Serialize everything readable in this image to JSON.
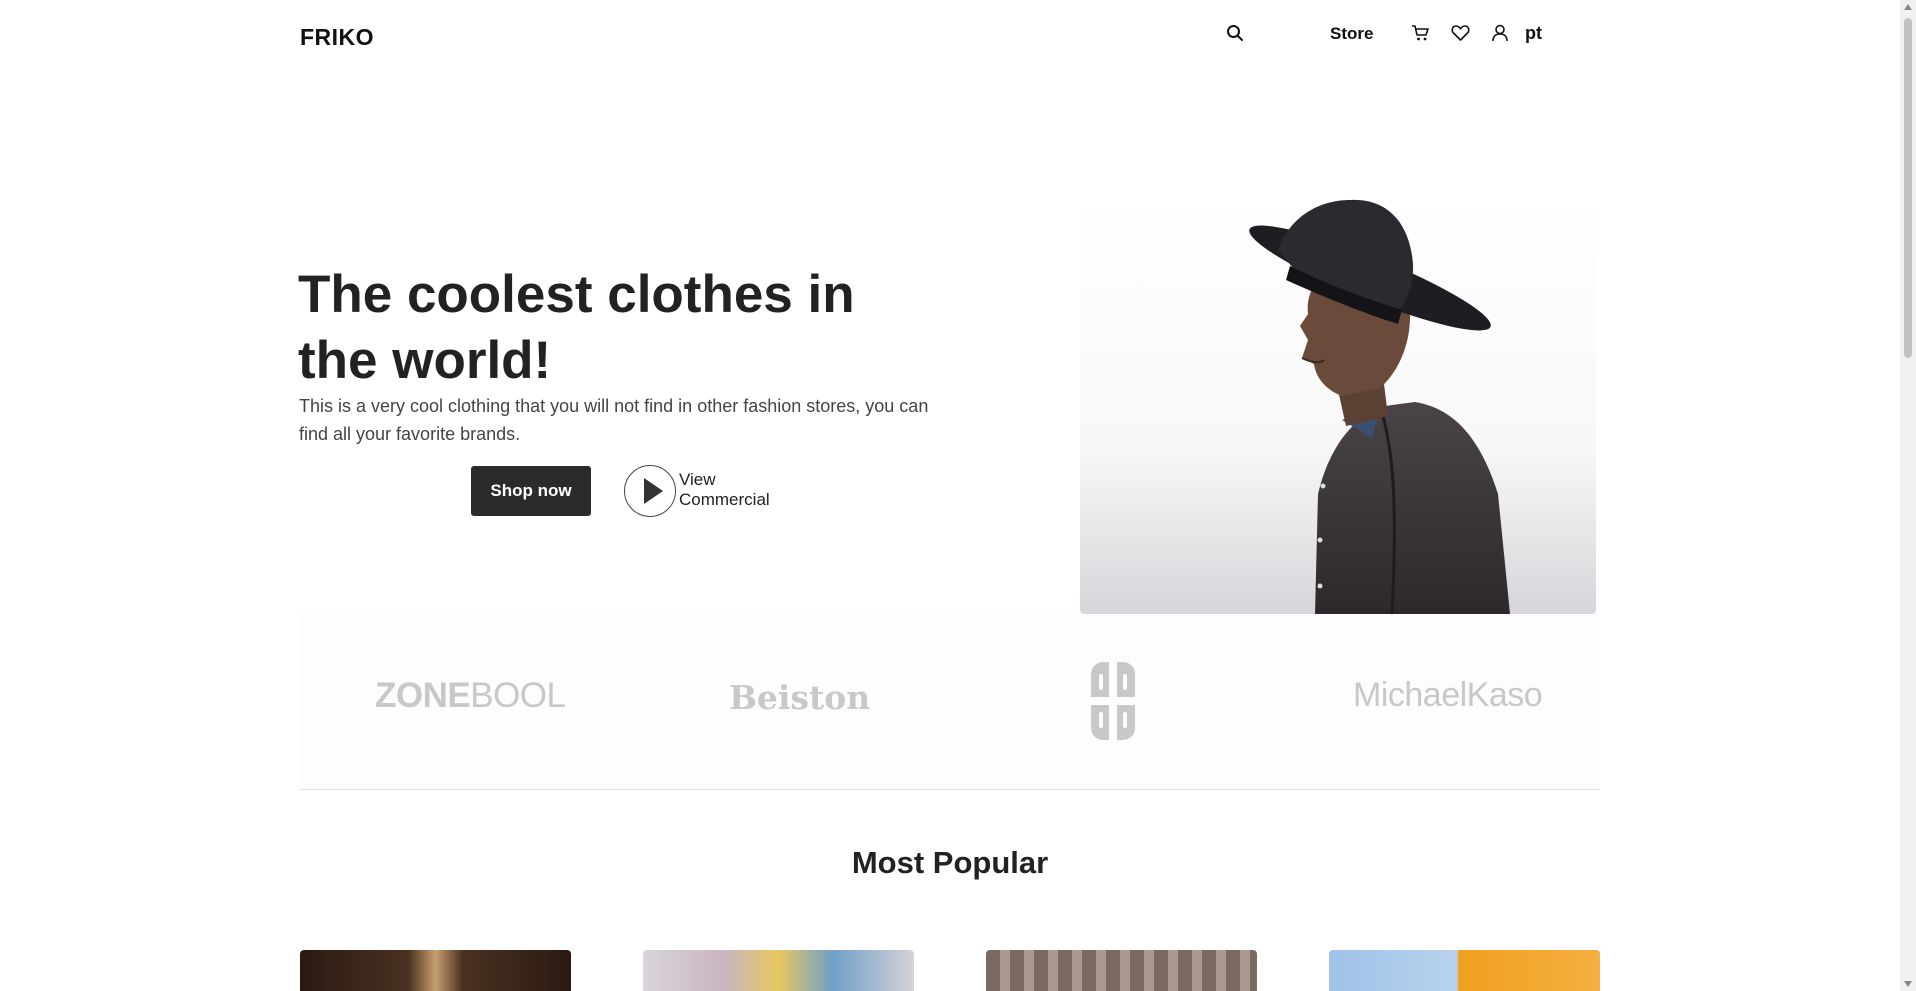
{
  "header": {
    "logo": "FRIKO",
    "store_label": "Store",
    "lang_label": "pt",
    "icons": [
      "search-icon",
      "cart-icon",
      "heart-icon",
      "user-icon"
    ]
  },
  "hero": {
    "title": "The coolest clothes in the world!",
    "subtitle": "This is a very cool clothing that you will not find in other fashion stores, you can find all your favorite brands.",
    "shop_button": "Shop now",
    "view_line1": "View",
    "view_line2": "Commercial"
  },
  "brands": {
    "zone_bold": "ZONE",
    "zone_light": "BOOL",
    "beiston": "Beiston",
    "michael": "MichaelKaso"
  },
  "popular": {
    "title": "Most Popular"
  },
  "colors": {
    "button_bg": "#2b2b2b",
    "text": "#222222",
    "brand_logo": "#c8c8c8"
  }
}
